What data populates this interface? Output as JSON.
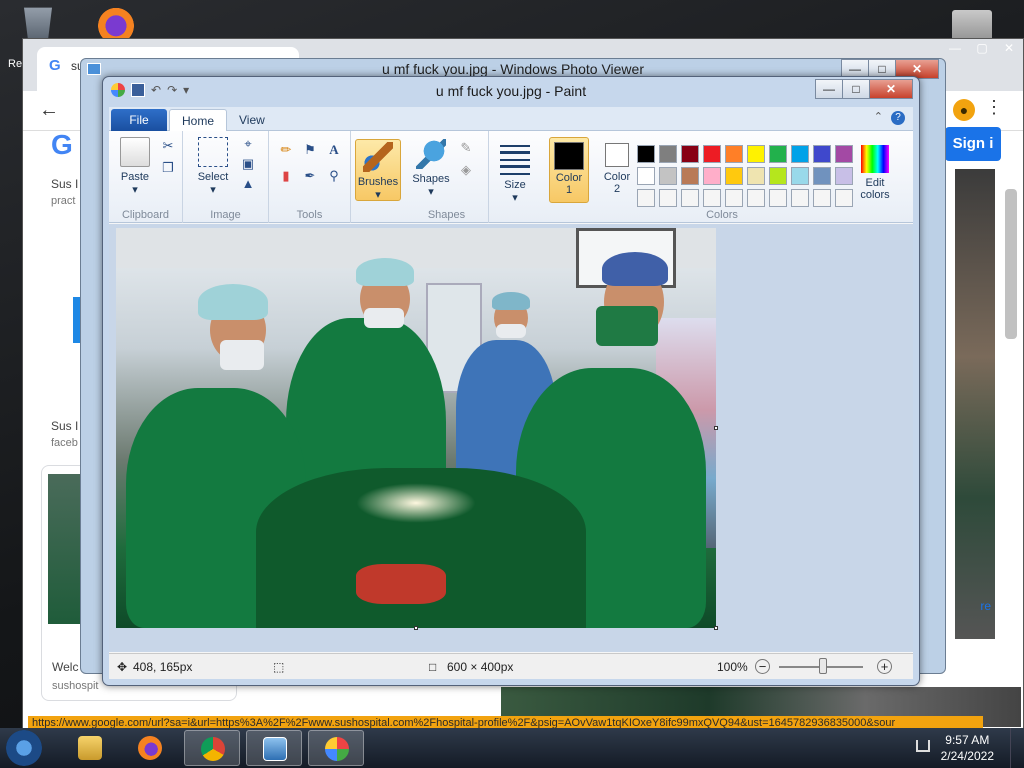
{
  "desktop": {
    "label_recycle": "Re"
  },
  "chrome": {
    "tab_title": "su",
    "google_logo": "G",
    "signin": "Sign i",
    "snippets": [
      {
        "title": "Sus I",
        "sub": "pract"
      },
      {
        "title": "Sus I",
        "sub": "faceb"
      }
    ],
    "card_title": "Welc",
    "card_sub": "sushospit",
    "more_link": "re"
  },
  "photo_viewer": {
    "title": "u mf fuck you.jpg - Windows Photo Viewer"
  },
  "paint": {
    "title": "u mf fuck you.jpg - Paint",
    "tabs": {
      "file": "File",
      "home": "Home",
      "view": "View"
    },
    "help": "?",
    "groups": {
      "clipboard": "Clipboard",
      "image": "Image",
      "tools": "Tools",
      "shapes": "Shapes",
      "colors": "Colors"
    },
    "buttons": {
      "paste": "Paste",
      "select": "Select",
      "brushes": "Brushes",
      "shapes": "Shapes",
      "size": "Size",
      "color1_a": "Color",
      "color1_b": "1",
      "color2_a": "Color",
      "color2_b": "2",
      "edit_a": "Edit",
      "edit_b": "colors"
    },
    "text_tool": "A",
    "palette": [
      "#000000",
      "#7f7f7f",
      "#880015",
      "#ed1c24",
      "#ff7f27",
      "#fff200",
      "#22b14c",
      "#00a2e8",
      "#3f48cc",
      "#a349a4",
      "#ffffff",
      "#c3c3c3",
      "#b97a57",
      "#ffaec9",
      "#ffc90e",
      "#efe4b0",
      "#b5e61d",
      "#99d9ea",
      "#7092be",
      "#c8bfe7",
      "#f5f5f5",
      "#f5f5f5",
      "#f5f5f5",
      "#f5f5f5",
      "#f5f5f5",
      "#f5f5f5",
      "#f5f5f5",
      "#f5f5f5",
      "#f5f5f5",
      "#f5f5f5"
    ],
    "status": {
      "cursor": "408, 165px",
      "size": "600 × 400px",
      "zoom": "100%"
    }
  },
  "browser_status_url": "https://www.google.com/url?sa=i&url=https%3A%2F%2Fwww.sushospital.com%2Fhospital-profile%2F&psig=AOvVaw1tqKIOxeY8ifc99mxQVQ94&ust=1645782936835000&sour",
  "taskbar": {
    "time": "9:57 AM",
    "date": "2/24/2022"
  }
}
